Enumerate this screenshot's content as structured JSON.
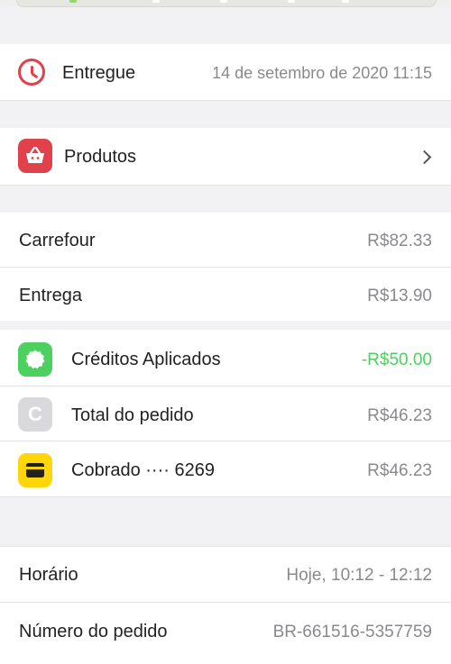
{
  "status": {
    "label": "Entregue",
    "datetime": "14 de setembro de 2020 11:15"
  },
  "products": {
    "label": "Produtos"
  },
  "summary": {
    "store": {
      "label": "Carrefour",
      "value": "R$82.33"
    },
    "delivery": {
      "label": "Entrega",
      "value": "R$13.90"
    }
  },
  "payment": {
    "credits": {
      "label": "Créditos Aplicados",
      "value": "-R$50.00"
    },
    "total": {
      "label": "Total do pedido",
      "value": "R$46.23",
      "icon_letter": "C"
    },
    "charged": {
      "label": "Cobrado ···· 6269",
      "value": "R$46.23"
    }
  },
  "details": {
    "time": {
      "label": "Horário",
      "value": "Hoje, 10:12 - 12:12"
    },
    "order": {
      "label": "Número do pedido",
      "value": "BR-661516-5357759"
    }
  },
  "colors": {
    "accent_red": "#e0414a",
    "credits_green": "#4cd160",
    "card_yellow": "#ffd60a",
    "placeholder_grey": "#d9d9dc"
  },
  "icons": {
    "status": "clock-icon",
    "products": "basket-icon",
    "products_nav": "chevron-right-icon",
    "credits": "badge-icon",
    "total": "letter-c-icon",
    "charged": "credit-card-icon"
  }
}
